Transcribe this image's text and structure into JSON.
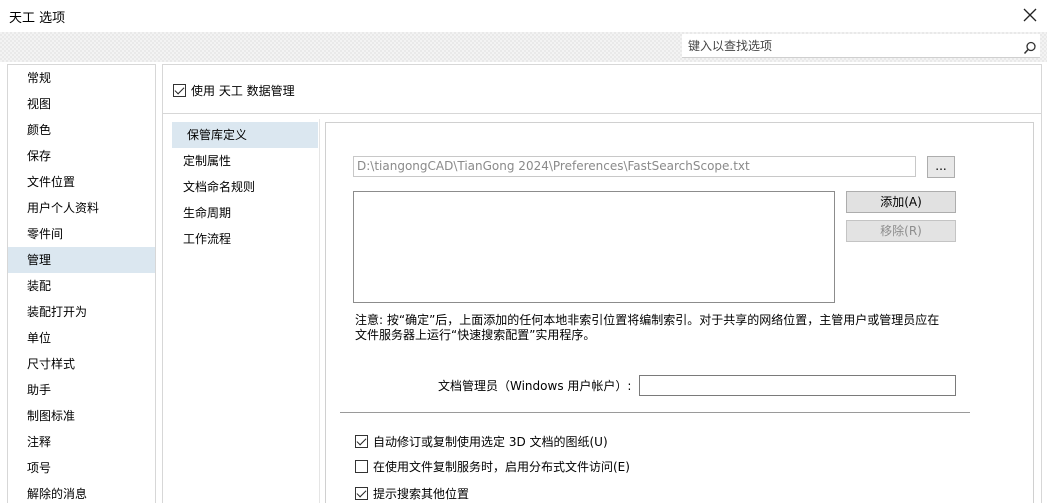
{
  "window": {
    "title": "天工 选项"
  },
  "search": {
    "placeholder": "键入以查找选项"
  },
  "sidebar": {
    "items": [
      {
        "label": "常规"
      },
      {
        "label": "视图"
      },
      {
        "label": "颜色"
      },
      {
        "label": "保存"
      },
      {
        "label": "文件位置"
      },
      {
        "label": "用户个人资料"
      },
      {
        "label": "零件间"
      },
      {
        "label": "管理"
      },
      {
        "label": "装配"
      },
      {
        "label": "装配打开为"
      },
      {
        "label": "单位"
      },
      {
        "label": "尺寸样式"
      },
      {
        "label": "助手"
      },
      {
        "label": "制图标准"
      },
      {
        "label": "注释"
      },
      {
        "label": "项号"
      },
      {
        "label": "解除的消息"
      }
    ],
    "active_index": 7
  },
  "main": {
    "enable_label": "使用 天工 数据管理",
    "enable_checked": true,
    "subnav": [
      {
        "label": "保管库定义"
      },
      {
        "label": "定制属性"
      },
      {
        "label": "文档命名规则"
      },
      {
        "label": "生命周期"
      },
      {
        "label": "工作流程"
      }
    ],
    "subnav_active_index": 0,
    "path_value": "D:\\tiangongCAD\\TianGong 2024\\Preferences\\FastSearchScope.txt",
    "browse_label": "...",
    "add_label": "添加(A)",
    "remove_label": "移除(R)",
    "note_line1": "注意: 按“确定”后，上面添加的任何本地非索引位置将编制索引。对于共享的网络位置，主管用户或管理员应在",
    "note_line2": "文件服务器上运行“快速搜索配置”实用程序。",
    "admin_label": "文档管理员（Windows 用户帐户）:",
    "admin_value": "",
    "options": [
      {
        "label": "自动修订或复制使用选定 3D 文档的图纸(U)",
        "checked": true
      },
      {
        "label": "在使用文件复制服务时，启用分布式文件访问(E)",
        "checked": false
      },
      {
        "label": "提示搜索其他位置",
        "checked": true
      }
    ]
  }
}
